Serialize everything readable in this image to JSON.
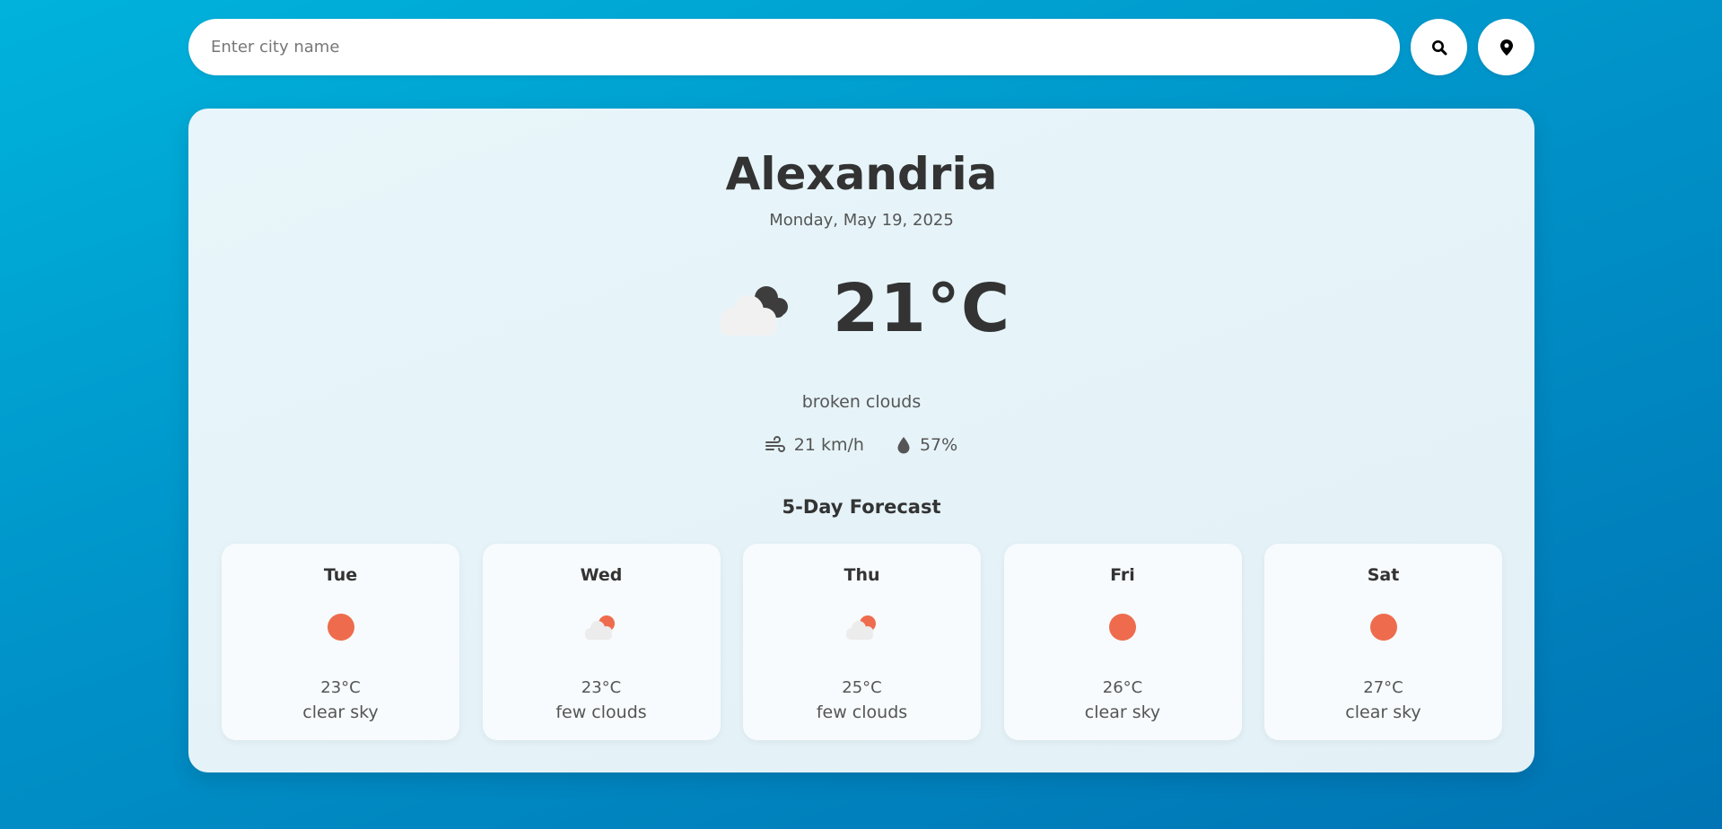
{
  "search": {
    "placeholder": "Enter city name",
    "search_icon": "search-icon",
    "location_icon": "location-pin-icon"
  },
  "current": {
    "city": "Alexandria",
    "date": "Monday, May 19, 2025",
    "icon": "broken-clouds-icon",
    "temperature": "21°C",
    "description": "broken clouds",
    "wind": "21 km/h",
    "wind_icon": "wind-icon",
    "humidity": "57%",
    "humidity_icon": "humidity-drop-icon"
  },
  "forecast": {
    "title": "5-Day Forecast",
    "days": [
      {
        "day": "Tue",
        "temp": "23°C",
        "desc": "clear sky",
        "icon": "clear-sky-icon"
      },
      {
        "day": "Wed",
        "temp": "23°C",
        "desc": "few clouds",
        "icon": "few-clouds-icon"
      },
      {
        "day": "Thu",
        "temp": "25°C",
        "desc": "few clouds",
        "icon": "few-clouds-icon"
      },
      {
        "day": "Fri",
        "temp": "26°C",
        "desc": "clear sky",
        "icon": "clear-sky-icon"
      },
      {
        "day": "Sat",
        "temp": "27°C",
        "desc": "clear sky",
        "icon": "clear-sky-icon"
      }
    ]
  },
  "colors": {
    "background_start": "#00b3dc",
    "background_end": "#0074b4",
    "card": "#e8f6fb",
    "sun": "#ee6c4d",
    "text_dark": "#333333",
    "text_muted": "#555555"
  }
}
